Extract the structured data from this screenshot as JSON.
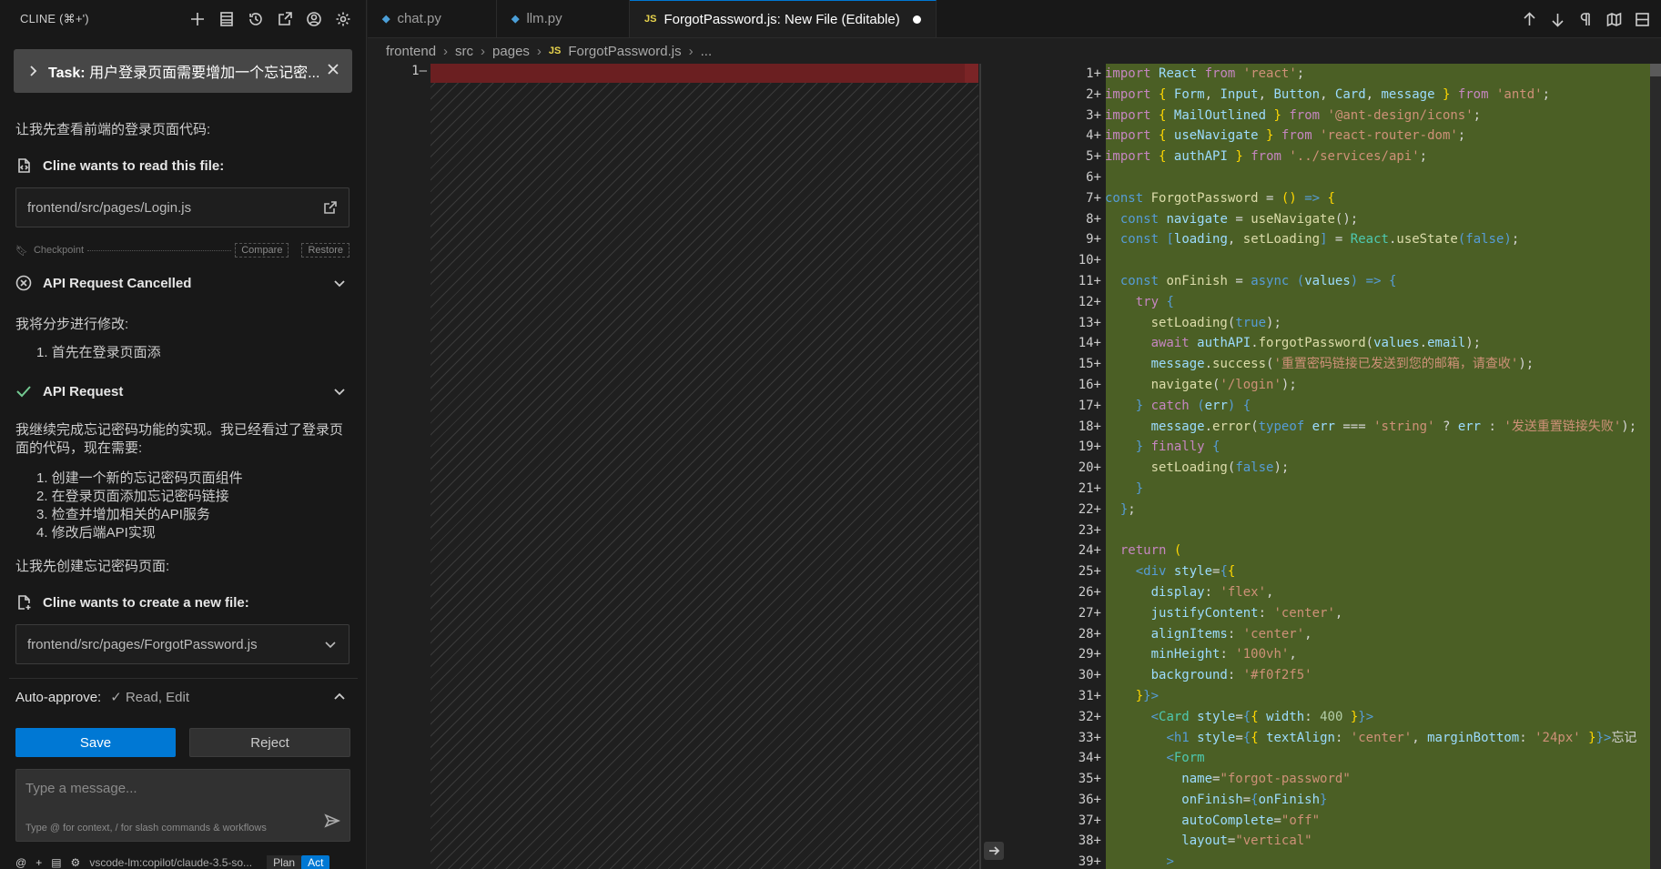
{
  "cline": {
    "title": "CLINE (⌘+')",
    "header_icons": [
      "plus-icon",
      "history-list-icon",
      "history-icon",
      "popout-icon",
      "account-icon",
      "gear-icon"
    ],
    "task_label": "Task:",
    "task_text": "用户登录页面需要增加一个忘记密...",
    "msg1": "让我先查看前端的登录页面代码:",
    "read_file_title": "Cline wants to read this file:",
    "read_file_path": "frontend/src/pages/Login.js",
    "checkpoint_label": "Checkpoint",
    "compare_label": "Compare",
    "restore_label": "Restore",
    "api_cancelled": "API Request Cancelled",
    "msg2": "我将分步进行修改:",
    "list1": [
      "1. 首先在登录页面添"
    ],
    "api_request": "API Request",
    "msg3": "我继续完成忘记密码功能的实现。我已经看过了登录页面的代码，现在需要:",
    "list2": [
      "1. 创建一个新的忘记密码页面组件",
      "2. 在登录页面添加忘记密码链接",
      "3. 检查并增加相关的API服务",
      "4. 修改后端API实现"
    ],
    "msg4": "让我先创建忘记密码页面:",
    "create_file_title": "Cline wants to create a new file:",
    "create_file_path": "frontend/src/pages/ForgotPassword.js",
    "auto_approve_label": "Auto-approve:",
    "auto_approve_value": "✓ Read, Edit",
    "save_label": "Save",
    "reject_label": "Reject",
    "input_placeholder": "Type a message...",
    "input_hint": "Type @ for context, / for slash commands & workflows",
    "model": "vscode-lm:copilot/claude-3.5-so...",
    "mode_plan": "Plan",
    "mode_act": "Act"
  },
  "editor": {
    "tabs": [
      {
        "label": "chat.py",
        "icon": "python-icon",
        "active": false
      },
      {
        "label": "llm.py",
        "icon": "python-icon",
        "active": false
      },
      {
        "label": "ForgotPassword.js: New File (Editable)",
        "icon": "js-icon",
        "active": true
      }
    ],
    "tab_actions": [
      "arrow-up-icon",
      "arrow-down-icon",
      "pilcrow-icon",
      "map-icon",
      "split-icon"
    ],
    "breadcrumb": [
      "frontend",
      "src",
      "pages",
      "ForgotPassword.js",
      "..."
    ],
    "left_line_number": "1—",
    "line_numbers": [
      "1+",
      "2+",
      "3+",
      "4+",
      "5+",
      "6+",
      "7+",
      "8+",
      "9+",
      "10+",
      "11+",
      "12+",
      "13+",
      "14+",
      "15+",
      "16+",
      "17+",
      "18+",
      "19+",
      "20+",
      "21+",
      "22+",
      "23+",
      "24+",
      "25+",
      "26+",
      "27+",
      "28+",
      "29+",
      "30+",
      "31+",
      "32+",
      "33+",
      "34+",
      "35+",
      "36+",
      "37+",
      "38+",
      "39+"
    ],
    "colors": {
      "added_bg": "#4b5f25",
      "removed_bg": "#6b1f21",
      "accent": "#0078d4"
    }
  },
  "code": [
    [
      [
        "k",
        "import"
      ],
      [
        "o",
        " "
      ],
      [
        "v",
        "React"
      ],
      [
        "o",
        " "
      ],
      [
        "k",
        "from"
      ],
      [
        "o",
        " "
      ],
      [
        "s",
        "'react'"
      ],
      [
        "o",
        ";"
      ]
    ],
    [
      [
        "k",
        "import"
      ],
      [
        "o",
        " "
      ],
      [
        "p",
        "{"
      ],
      [
        "o",
        " "
      ],
      [
        "v",
        "Form"
      ],
      [
        "o",
        ", "
      ],
      [
        "v",
        "Input"
      ],
      [
        "o",
        ", "
      ],
      [
        "v",
        "Button"
      ],
      [
        "o",
        ", "
      ],
      [
        "v",
        "Card"
      ],
      [
        "o",
        ", "
      ],
      [
        "v",
        "message"
      ],
      [
        "o",
        " "
      ],
      [
        "p",
        "}"
      ],
      [
        "o",
        " "
      ],
      [
        "k",
        "from"
      ],
      [
        "o",
        " "
      ],
      [
        "s",
        "'antd'"
      ],
      [
        "o",
        ";"
      ]
    ],
    [
      [
        "k",
        "import"
      ],
      [
        "o",
        " "
      ],
      [
        "p",
        "{"
      ],
      [
        "o",
        " "
      ],
      [
        "v",
        "MailOutlined"
      ],
      [
        "o",
        " "
      ],
      [
        "p",
        "}"
      ],
      [
        "o",
        " "
      ],
      [
        "k",
        "from"
      ],
      [
        "o",
        " "
      ],
      [
        "s",
        "'@ant-design/icons'"
      ],
      [
        "o",
        ";"
      ]
    ],
    [
      [
        "k",
        "import"
      ],
      [
        "o",
        " "
      ],
      [
        "p",
        "{"
      ],
      [
        "o",
        " "
      ],
      [
        "v",
        "useNavigate"
      ],
      [
        "o",
        " "
      ],
      [
        "p",
        "}"
      ],
      [
        "o",
        " "
      ],
      [
        "k",
        "from"
      ],
      [
        "o",
        " "
      ],
      [
        "s",
        "'react-router-dom'"
      ],
      [
        "o",
        ";"
      ]
    ],
    [
      [
        "k",
        "import"
      ],
      [
        "o",
        " "
      ],
      [
        "p",
        "{"
      ],
      [
        "o",
        " "
      ],
      [
        "v",
        "authAPI"
      ],
      [
        "o",
        " "
      ],
      [
        "p",
        "}"
      ],
      [
        "o",
        " "
      ],
      [
        "k",
        "from"
      ],
      [
        "o",
        " "
      ],
      [
        "s",
        "'../services/api'"
      ],
      [
        "o",
        ";"
      ]
    ],
    [],
    [
      [
        "kw",
        "const"
      ],
      [
        "o",
        " "
      ],
      [
        "f",
        "ForgotPassword"
      ],
      [
        "o",
        " = "
      ],
      [
        "p",
        "()"
      ],
      [
        "o",
        " "
      ],
      [
        "kw",
        "=>"
      ],
      [
        "o",
        " "
      ],
      [
        "p",
        "{"
      ]
    ],
    [
      [
        "o",
        "  "
      ],
      [
        "kw",
        "const"
      ],
      [
        "o",
        " "
      ],
      [
        "v",
        "navigate"
      ],
      [
        "o",
        " = "
      ],
      [
        "f",
        "useNavigate"
      ],
      [
        "o",
        "();"
      ]
    ],
    [
      [
        "o",
        "  "
      ],
      [
        "kw",
        "const"
      ],
      [
        "o",
        " "
      ],
      [
        "kw",
        "["
      ],
      [
        "v",
        "loading"
      ],
      [
        "o",
        ", "
      ],
      [
        "f",
        "setLoading"
      ],
      [
        "kw",
        "]"
      ],
      [
        "o",
        " = "
      ],
      [
        "c",
        "React"
      ],
      [
        "o",
        "."
      ],
      [
        "f",
        "useState"
      ],
      [
        "kw",
        "("
      ],
      [
        "kw",
        "false"
      ],
      [
        "kw",
        ")"
      ],
      [
        "o",
        ";"
      ]
    ],
    [],
    [
      [
        "o",
        "  "
      ],
      [
        "kw",
        "const"
      ],
      [
        "o",
        " "
      ],
      [
        "f",
        "onFinish"
      ],
      [
        "o",
        " = "
      ],
      [
        "kw",
        "async"
      ],
      [
        "o",
        " "
      ],
      [
        "kw",
        "("
      ],
      [
        "v",
        "values"
      ],
      [
        "kw",
        ")"
      ],
      [
        "o",
        " "
      ],
      [
        "kw",
        "=>"
      ],
      [
        "o",
        " "
      ],
      [
        "kw",
        "{"
      ]
    ],
    [
      [
        "o",
        "    "
      ],
      [
        "k",
        "try"
      ],
      [
        "o",
        " "
      ],
      [
        "kw",
        "{"
      ]
    ],
    [
      [
        "o",
        "      "
      ],
      [
        "f",
        "setLoading"
      ],
      [
        "o",
        "("
      ],
      [
        "kw",
        "true"
      ],
      [
        "o",
        ");"
      ]
    ],
    [
      [
        "o",
        "      "
      ],
      [
        "k",
        "await"
      ],
      [
        "o",
        " "
      ],
      [
        "v",
        "authAPI"
      ],
      [
        "o",
        "."
      ],
      [
        "f",
        "forgotPassword"
      ],
      [
        "o",
        "("
      ],
      [
        "v",
        "values"
      ],
      [
        "o",
        "."
      ],
      [
        "v",
        "email"
      ],
      [
        "o",
        ");"
      ]
    ],
    [
      [
        "o",
        "      "
      ],
      [
        "v",
        "message"
      ],
      [
        "o",
        "."
      ],
      [
        "f",
        "success"
      ],
      [
        "o",
        "("
      ],
      [
        "s",
        "'重置密码链接已发送到您的邮箱，请查收'"
      ],
      [
        "o",
        ");"
      ]
    ],
    [
      [
        "o",
        "      "
      ],
      [
        "f",
        "navigate"
      ],
      [
        "o",
        "("
      ],
      [
        "s",
        "'/login'"
      ],
      [
        "o",
        ");"
      ]
    ],
    [
      [
        "o",
        "    "
      ],
      [
        "kw",
        "}"
      ],
      [
        "o",
        " "
      ],
      [
        "k",
        "catch"
      ],
      [
        "o",
        " "
      ],
      [
        "kw",
        "("
      ],
      [
        "v",
        "err"
      ],
      [
        "kw",
        ")"
      ],
      [
        "o",
        " "
      ],
      [
        "kw",
        "{"
      ]
    ],
    [
      [
        "o",
        "      "
      ],
      [
        "v",
        "message"
      ],
      [
        "o",
        "."
      ],
      [
        "f",
        "error"
      ],
      [
        "o",
        "("
      ],
      [
        "kw",
        "typeof"
      ],
      [
        "o",
        " "
      ],
      [
        "v",
        "err"
      ],
      [
        "o",
        " === "
      ],
      [
        "s",
        "'string'"
      ],
      [
        "o",
        " ? "
      ],
      [
        "v",
        "err"
      ],
      [
        "o",
        " : "
      ],
      [
        "s",
        "'发送重置链接失败'"
      ],
      [
        "o",
        ");"
      ]
    ],
    [
      [
        "o",
        "    "
      ],
      [
        "kw",
        "}"
      ],
      [
        "o",
        " "
      ],
      [
        "k",
        "finally"
      ],
      [
        "o",
        " "
      ],
      [
        "kw",
        "{"
      ]
    ],
    [
      [
        "o",
        "      "
      ],
      [
        "f",
        "setLoading"
      ],
      [
        "o",
        "("
      ],
      [
        "kw",
        "false"
      ],
      [
        "o",
        ");"
      ]
    ],
    [
      [
        "o",
        "    "
      ],
      [
        "kw",
        "}"
      ]
    ],
    [
      [
        "o",
        "  "
      ],
      [
        "kw",
        "}"
      ],
      [
        "o",
        ";"
      ]
    ],
    [],
    [
      [
        "o",
        "  "
      ],
      [
        "k",
        "return"
      ],
      [
        "o",
        " "
      ],
      [
        "p",
        "("
      ]
    ],
    [
      [
        "o",
        "    "
      ],
      [
        "t",
        "<div"
      ],
      [
        "o",
        " "
      ],
      [
        "a",
        "style"
      ],
      [
        "o",
        "="
      ],
      [
        "kw",
        "{"
      ],
      [
        "p",
        "{"
      ]
    ],
    [
      [
        "o",
        "      "
      ],
      [
        "v",
        "display"
      ],
      [
        "o",
        ": "
      ],
      [
        "s",
        "'flex'"
      ],
      [
        "o",
        ","
      ]
    ],
    [
      [
        "o",
        "      "
      ],
      [
        "v",
        "justifyContent"
      ],
      [
        "o",
        ": "
      ],
      [
        "s",
        "'center'"
      ],
      [
        "o",
        ","
      ]
    ],
    [
      [
        "o",
        "      "
      ],
      [
        "v",
        "alignItems"
      ],
      [
        "o",
        ": "
      ],
      [
        "s",
        "'center'"
      ],
      [
        "o",
        ","
      ]
    ],
    [
      [
        "o",
        "      "
      ],
      [
        "v",
        "minHeight"
      ],
      [
        "o",
        ": "
      ],
      [
        "s",
        "'100vh'"
      ],
      [
        "o",
        ","
      ]
    ],
    [
      [
        "o",
        "      "
      ],
      [
        "v",
        "background"
      ],
      [
        "o",
        ": "
      ],
      [
        "s",
        "'#f0f2f5'"
      ]
    ],
    [
      [
        "o",
        "    "
      ],
      [
        "p",
        "}"
      ],
      [
        "kw",
        "}"
      ],
      [
        "t",
        ">"
      ]
    ],
    [
      [
        "o",
        "      "
      ],
      [
        "t",
        "<"
      ],
      [
        "c",
        "Card"
      ],
      [
        "o",
        " "
      ],
      [
        "a",
        "style"
      ],
      [
        "o",
        "="
      ],
      [
        "kw",
        "{"
      ],
      [
        "p",
        "{"
      ],
      [
        "o",
        " "
      ],
      [
        "v",
        "width"
      ],
      [
        "o",
        ": "
      ],
      [
        "n",
        "400"
      ],
      [
        "o",
        " "
      ],
      [
        "p",
        "}"
      ],
      [
        "kw",
        "}"
      ],
      [
        "t",
        ">"
      ]
    ],
    [
      [
        "o",
        "        "
      ],
      [
        "t",
        "<"
      ],
      [
        "kw",
        "h1"
      ],
      [
        "o",
        " "
      ],
      [
        "a",
        "style"
      ],
      [
        "o",
        "="
      ],
      [
        "kw",
        "{"
      ],
      [
        "p",
        "{"
      ],
      [
        "o",
        " "
      ],
      [
        "v",
        "textAlign"
      ],
      [
        "o",
        ": "
      ],
      [
        "s",
        "'center'"
      ],
      [
        "o",
        ", "
      ],
      [
        "v",
        "marginBottom"
      ],
      [
        "o",
        ": "
      ],
      [
        "s",
        "'24px'"
      ],
      [
        "o",
        " "
      ],
      [
        "p",
        "}"
      ],
      [
        "kw",
        "}"
      ],
      [
        "t",
        ">"
      ],
      [
        "o",
        "忘记"
      ]
    ],
    [
      [
        "o",
        "        "
      ],
      [
        "t",
        "<"
      ],
      [
        "c",
        "Form"
      ]
    ],
    [
      [
        "o",
        "          "
      ],
      [
        "a",
        "name"
      ],
      [
        "o",
        "="
      ],
      [
        "s",
        "\"forgot-password\""
      ]
    ],
    [
      [
        "o",
        "          "
      ],
      [
        "a",
        "onFinish"
      ],
      [
        "o",
        "="
      ],
      [
        "kw",
        "{"
      ],
      [
        "v",
        "onFinish"
      ],
      [
        "kw",
        "}"
      ]
    ],
    [
      [
        "o",
        "          "
      ],
      [
        "a",
        "autoComplete"
      ],
      [
        "o",
        "="
      ],
      [
        "s",
        "\"off\""
      ]
    ],
    [
      [
        "o",
        "          "
      ],
      [
        "a",
        "layout"
      ],
      [
        "o",
        "="
      ],
      [
        "s",
        "\"vertical\""
      ]
    ],
    [
      [
        "o",
        "        "
      ],
      [
        "t",
        ">"
      ]
    ]
  ]
}
